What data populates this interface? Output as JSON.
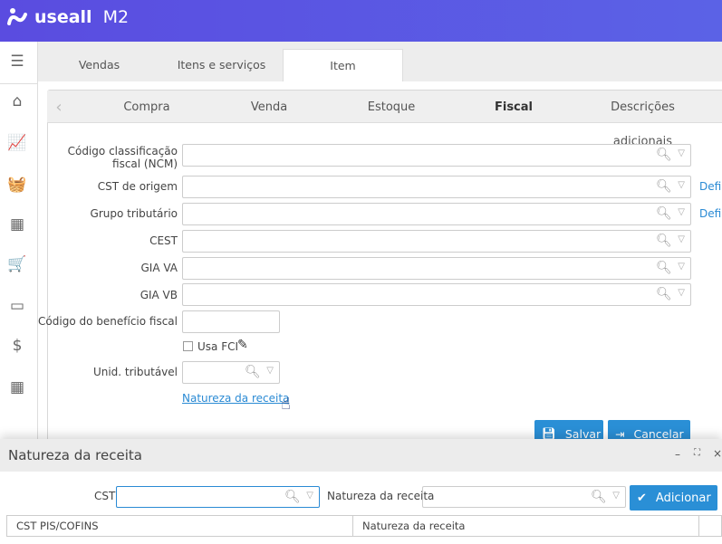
{
  "app": {
    "logo_text": "useall",
    "logo_suffix": "M2",
    "brand_color": "#5a4ce0"
  },
  "sidebar": {
    "items": [
      {
        "icon": "menu-icon"
      },
      {
        "icon": "home-icon"
      },
      {
        "icon": "chart-icon"
      },
      {
        "icon": "basket-icon"
      },
      {
        "icon": "boxes-icon"
      },
      {
        "icon": "cart-add-icon"
      },
      {
        "icon": "card-icon"
      },
      {
        "icon": "dollar-icon"
      },
      {
        "icon": "calculator-icon"
      }
    ]
  },
  "tabs": [
    {
      "label": "Vendas"
    },
    {
      "label": "Itens e serviços"
    },
    {
      "label": "Item",
      "active": true
    }
  ],
  "subtabs": [
    {
      "label": "Compra"
    },
    {
      "label": "Venda"
    },
    {
      "label": "Estoque"
    },
    {
      "label": "Fiscal",
      "active": true
    },
    {
      "label": "Descrições adicionais"
    }
  ],
  "form": {
    "ncm": {
      "label": "Código classificação fiscal (NCM)",
      "value": ""
    },
    "cst_origem": {
      "label": "CST de origem",
      "value": "",
      "link": "Defi"
    },
    "grupo": {
      "label": "Grupo tributário",
      "value": "",
      "link": "Defi"
    },
    "cest": {
      "label": "CEST",
      "value": ""
    },
    "gia_va": {
      "label": "GIA VA",
      "value": ""
    },
    "gia_vb": {
      "label": "GIA VB",
      "value": ""
    },
    "beneficio": {
      "label": "Código do benefício fiscal",
      "value": ""
    },
    "usa_fci": {
      "label": "Usa FCI",
      "checked": false
    },
    "unid": {
      "label": "Unid. tributável",
      "value": ""
    },
    "natureza_link": "Natureza da receita"
  },
  "buttons": {
    "save": "Salvar",
    "cancel": "Cancelar"
  },
  "modal": {
    "title": "Natureza da receita",
    "cst_label": "CST",
    "cst_value": "",
    "natureza_label": "Natureza da receita",
    "natureza_value": "",
    "add": "Adicionar",
    "columns": [
      "CST PIS/COFINS",
      "Natureza da receita",
      ""
    ]
  }
}
